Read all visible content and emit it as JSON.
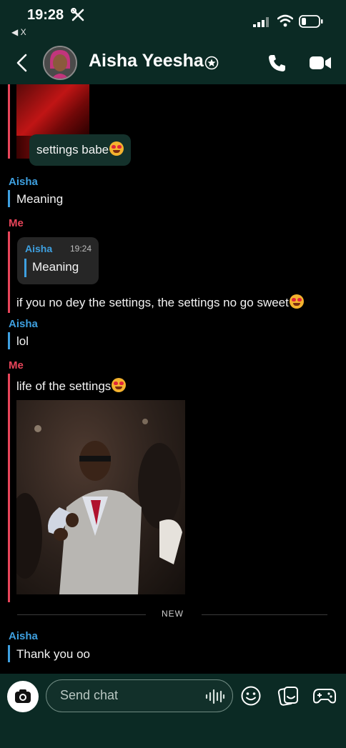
{
  "status_bar": {
    "time": "19:28",
    "back_app": "◀ X",
    "tools_icon": "wrench-screwdriver-icon",
    "signal_icon": "cellular-signal-icon",
    "wifi_icon": "wifi-icon",
    "battery_icon": "battery-low-icon"
  },
  "header": {
    "contact_name": "Aisha Yeesha",
    "back_icon": "chevron-left-icon",
    "badge_icon": "star-badge-icon",
    "call_icon": "phone-icon",
    "video_icon": "video-camera-icon"
  },
  "messages": {
    "snap_caption": "settings babe",
    "m1_sender": "Aisha",
    "m1_text": "Meaning",
    "m2_sender": "Me",
    "m2_quote_sender": "Aisha",
    "m2_quote_time": "19:24",
    "m2_quote_text": "Meaning",
    "m2_text": "if you no dey the settings, the settings no go sweet",
    "m3_sender": "Aisha",
    "m3_text": "lol",
    "m4_sender": "Me",
    "m4_text": "life of the settings",
    "new_divider": "NEW",
    "m5_sender": "Aisha",
    "m5_text": "Thank you oo"
  },
  "composer": {
    "placeholder": "Send chat",
    "camera_icon": "camera-icon",
    "voice_icon": "voice-waveform-icon",
    "emoji_icon": "smiley-icon",
    "sticker_icon": "sticker-icon",
    "game_icon": "game-controller-icon"
  },
  "colors": {
    "bar_background": "#0b2a24",
    "aisha_accent": "#3ea0e0",
    "me_accent": "#e8455a"
  }
}
